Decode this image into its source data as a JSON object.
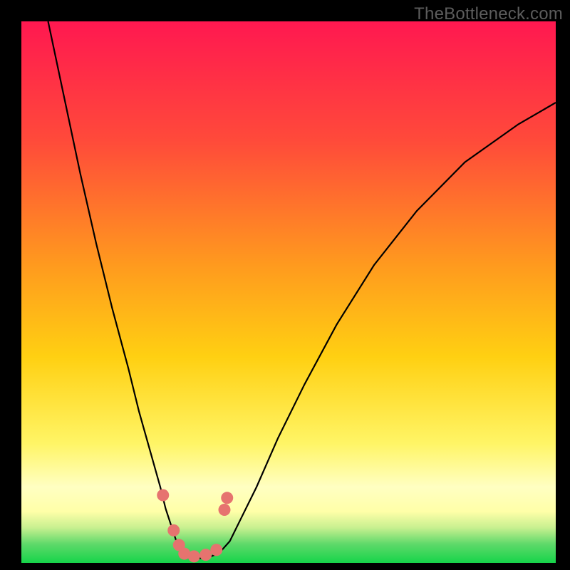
{
  "watermark": "TheBottleneck.com",
  "colors": {
    "page_bg": "#000000",
    "watermark_color": "#5c5c5c",
    "gradient_top": "#ff1850",
    "gradient_mid_upper": "#ff7030",
    "gradient_mid": "#ffc812",
    "gradient_mid_lower": "#fff566",
    "gradient_pale": "#ffffc2",
    "gradient_green_light": "#7ae67c",
    "gradient_green": "#16d44a",
    "curve_stroke": "#000000",
    "marker_fill": "#e6736f"
  },
  "chart_data": {
    "type": "line",
    "title": "",
    "xlabel": "",
    "ylabel": "",
    "xlim": [
      0,
      100
    ],
    "ylim": [
      0,
      100
    ],
    "series": [
      {
        "name": "curve",
        "x": [
          5,
          8,
          11,
          14,
          17,
          20,
          22,
          24,
          26,
          27,
          28,
          29,
          30,
          31,
          32,
          33,
          35,
          37,
          39,
          41,
          44,
          48,
          53,
          59,
          66,
          74,
          83,
          93,
          100
        ],
        "values": [
          100,
          86,
          72,
          59,
          47,
          36,
          28,
          21,
          14,
          10,
          7,
          4,
          2.2,
          1.2,
          0.8,
          0.8,
          1.0,
          1.8,
          4,
          8,
          14,
          23,
          33,
          44,
          55,
          65,
          74,
          81,
          85
        ]
      }
    ],
    "markers": [
      {
        "x": 26.5,
        "y": 12.5
      },
      {
        "x": 28.5,
        "y": 6.0
      },
      {
        "x": 29.5,
        "y": 3.3
      },
      {
        "x": 30.5,
        "y": 1.7
      },
      {
        "x": 32.3,
        "y": 1.2
      },
      {
        "x": 34.5,
        "y": 1.5
      },
      {
        "x": 36.5,
        "y": 2.4
      },
      {
        "x": 38.0,
        "y": 9.8
      },
      {
        "x": 38.5,
        "y": 12.0
      }
    ],
    "gradient_stops": [
      {
        "offset": 0.0,
        "color": "#ff1850"
      },
      {
        "offset": 0.22,
        "color": "#ff4a3a"
      },
      {
        "offset": 0.45,
        "color": "#ff9a1e"
      },
      {
        "offset": 0.62,
        "color": "#ffd012"
      },
      {
        "offset": 0.78,
        "color": "#fff566"
      },
      {
        "offset": 0.86,
        "color": "#ffffc2"
      },
      {
        "offset": 0.905,
        "color": "#ffffa8"
      },
      {
        "offset": 0.935,
        "color": "#c8f090"
      },
      {
        "offset": 0.965,
        "color": "#5fd96a"
      },
      {
        "offset": 1.0,
        "color": "#16d44a"
      }
    ]
  }
}
